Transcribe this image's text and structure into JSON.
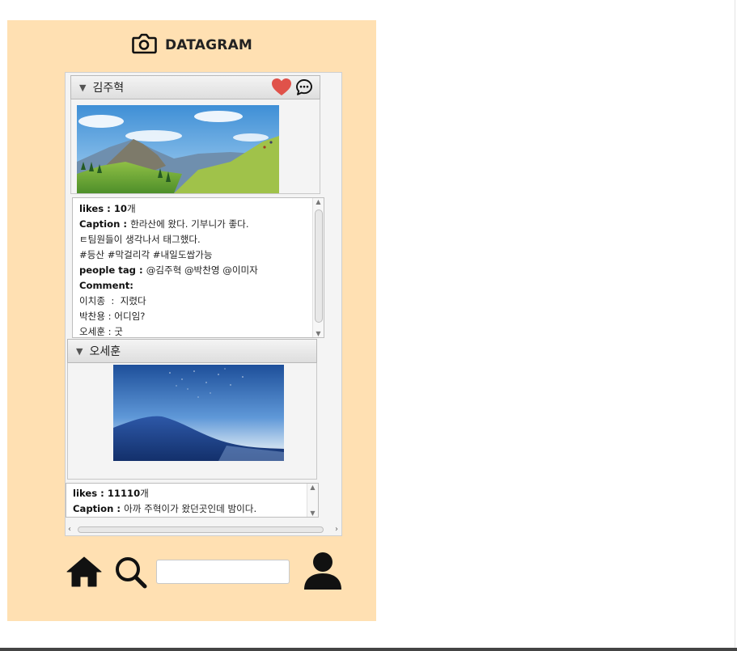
{
  "app": {
    "title": "DATAGRAM"
  },
  "posts": [
    {
      "user": "김주혁",
      "likes_label": "likes : ",
      "likes_value": "10",
      "likes_suffix": "개",
      "caption_label": "Caption : ",
      "caption": "한라산에 왔다. 기부니가 좋다.",
      "caption_line2": "ㅌ팀원들이 생각나서 태그했다.",
      "hashtags": "#등산 #막걸리각 #내일도쌉가능",
      "people_tag_label": "people tag : ",
      "people_tags": "@김주혁 @박찬영 @이미자",
      "comment_label": "Comment:",
      "comments": [
        {
          "author": "이치종",
          "sep": "  :  ",
          "text": "지렸다"
        },
        {
          "author": "박찬용",
          "sep": " : ",
          "text": "어디임?"
        },
        {
          "author": "오세훈",
          "sep": " : ",
          "text": "굿"
        }
      ]
    },
    {
      "user": "오세훈",
      "likes_label": "likes : ",
      "likes_value": "11110",
      "likes_suffix": "개",
      "caption_label": "Caption : ",
      "caption": "아까 주혁이가 왔던곳인데 밤이다."
    }
  ],
  "search": {
    "placeholder": ""
  },
  "icons": {
    "camera": "camera-icon",
    "heart": "heart-icon",
    "comment": "comment-icon",
    "home": "home-icon",
    "search": "search-icon",
    "profile": "user-icon"
  },
  "colors": {
    "app_background": "#ffe0b2",
    "heart": "#e0524a"
  }
}
